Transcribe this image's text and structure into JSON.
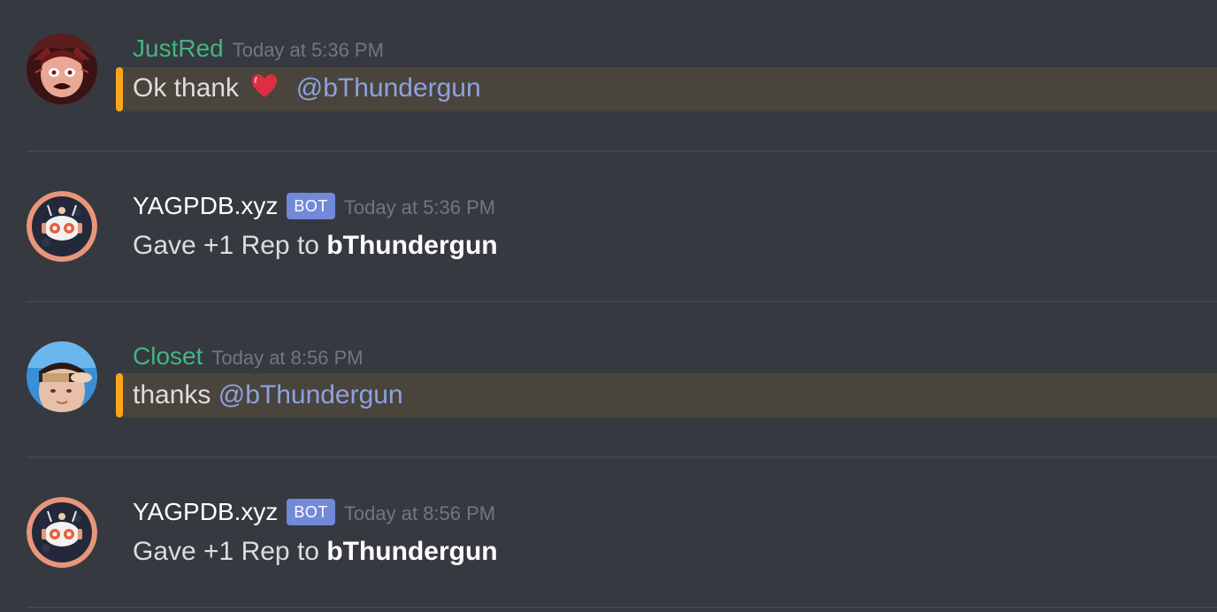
{
  "messages": [
    {
      "username": "JustRed",
      "timestamp": "Today at 5:36 PM",
      "text_before": "Ok thank",
      "emoji": "heart",
      "mention": "@bThundergun",
      "highlighted": true
    },
    {
      "username": "YAGPDB.xyz",
      "bot_tag": "BOT",
      "timestamp": "Today at 5:36 PM",
      "text_before": "Gave +1 Rep to ",
      "bold": "bThundergun"
    },
    {
      "username": "Closet",
      "timestamp": "Today at 8:56 PM",
      "text_before": "thanks ",
      "mention": "@bThundergun",
      "highlighted": true
    },
    {
      "username": "YAGPDB.xyz",
      "bot_tag": "BOT",
      "timestamp": "Today at 8:56 PM",
      "text_before": "Gave +1 Rep to ",
      "bold": "bThundergun"
    }
  ],
  "colors": {
    "background": "#36393f",
    "username_member": "#43b581",
    "bot_tag": "#7289da",
    "mention": "#8ea1e1",
    "highlight_bg": "#49443c",
    "highlight_bar": "#faa61a",
    "timestamp": "#72767d"
  }
}
